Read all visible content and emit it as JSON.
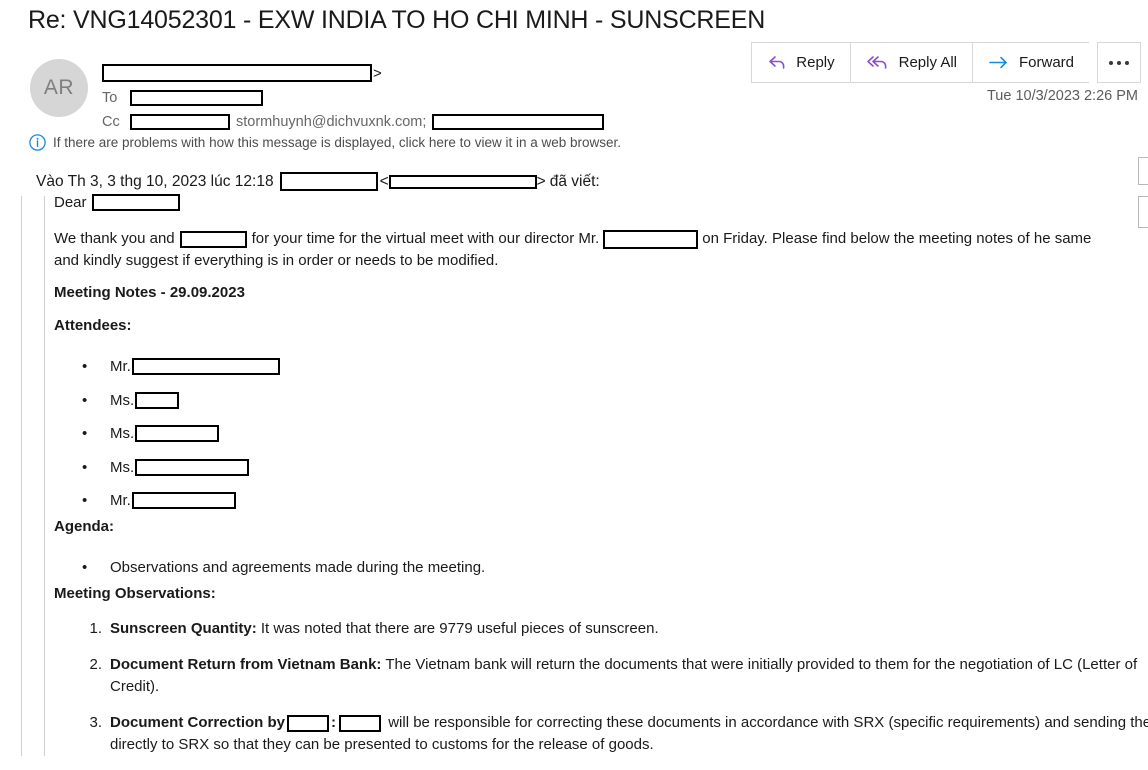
{
  "subject": "Re: VNG14052301 - EXW INDIA TO HO CHI MINH - SUNSCREEN",
  "header": {
    "avatar_initials": "AR",
    "to_label": "To",
    "cc_label": "Cc",
    "cc_visible_email": "stormhuynh@dichvuxnk.com;",
    "angle_bracket": ">",
    "date": "Tue 10/3/2023 2:26 PM"
  },
  "toolbar": {
    "reply_label": "Reply",
    "reply_all_label": "Reply All",
    "forward_label": "Forward",
    "more_label": "",
    "reply_icon_color": "#8c4fc4",
    "forward_icon_color": "#1a8ae0"
  },
  "infobar": {
    "text": "If there are problems with how this message is displayed, click here to view it in a web browser.",
    "icon_color": "#1a8ae0"
  },
  "body": {
    "quote_intro_prefix": "Vào Th 3, 3 thg 10, 2023 lúc 12:18",
    "quote_intro_suffix": "đã viết:",
    "greeting": "Dear",
    "paragraph_1_part_1": "We thank you and",
    "paragraph_1_part_2": "for your time for the virtual meet with our director Mr.",
    "paragraph_1_part_3": "on Friday. Please find below the meeting notes of he same and kindly suggest if everything is in order or needs to be modified.",
    "meeting_notes_heading": "Meeting Notes - 29.09.2023",
    "attendees_heading": "Attendees:",
    "attendees": [
      {
        "title": "Mr.",
        "redact_width": 148
      },
      {
        "title": "Ms.",
        "redact_width": 44
      },
      {
        "title": "Ms.",
        "redact_width": 84
      },
      {
        "title": "Ms.",
        "redact_width": 114
      },
      {
        "title": "Mr.",
        "redact_width": 104
      }
    ],
    "agenda_heading": "Agenda:",
    "agenda_items": [
      "Observations and agreements made during the meeting."
    ],
    "observations_heading": "Meeting Observations:",
    "observations": [
      {
        "marker": "1.",
        "bold": "Sunscreen Quantity:",
        "text": " It was noted that there are 9779 useful pieces of sunscreen."
      },
      {
        "marker": "2.",
        "bold": "Document Return from Vietnam Bank:",
        "text": " The Vietnam bank will return the documents that were initially provided to them for the negotiation of LC (Letter of Credit)."
      },
      {
        "marker": "3.",
        "bold": "Document Correction by",
        "text_mid": ":",
        "text": " will be responsible for correcting these documents in accordance with SRX (specific requirements) and sending them directly to SRX so that they can be presented to customs for the release of goods."
      }
    ]
  }
}
